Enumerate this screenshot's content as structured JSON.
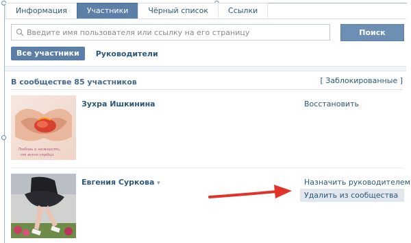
{
  "tabs": [
    {
      "label": "Информация",
      "active": false
    },
    {
      "label": "Участники",
      "active": true
    },
    {
      "label": "Чёрный список",
      "active": false
    },
    {
      "label": "Ссылки",
      "active": false
    }
  ],
  "search": {
    "placeholder": "Введите имя пользователя или ссылку на его страницу",
    "button_label": "Поиск",
    "icon": "search-icon"
  },
  "filters": {
    "all_label": "Все участники",
    "leaders_label": "Руководители"
  },
  "members_header": {
    "count_text": "В сообществе 85 участников",
    "blocked_link": "[ Заблокированные ]"
  },
  "members": [
    {
      "name": "Зухра Ишкинина",
      "actions": [
        "Восстановить"
      ]
    },
    {
      "name": "Евгения Суркова",
      "name_suffix": "▾",
      "actions": [
        "Назначить руководителем",
        "Удалить из сообщества"
      ],
      "highlighted_action": "Удалить из сообщества"
    }
  ],
  "colors": {
    "accent": "#5b7fa6",
    "link": "#2b587a",
    "annotation_arrow": "#e0342b"
  }
}
